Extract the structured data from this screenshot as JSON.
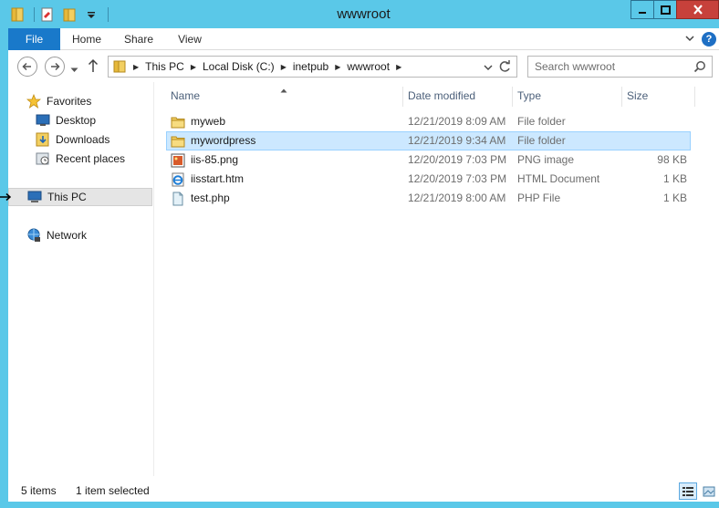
{
  "window": {
    "title": "wwwroot"
  },
  "ribbon": {
    "tabs": [
      {
        "label": "File"
      },
      {
        "label": "Home"
      },
      {
        "label": "Share"
      },
      {
        "label": "View"
      }
    ]
  },
  "address": {
    "crumbs": [
      "This PC",
      "Local Disk (C:)",
      "inetpub",
      "wwwroot"
    ]
  },
  "search": {
    "placeholder": "Search wwwroot"
  },
  "navpane": {
    "favorites": "Favorites",
    "desktop": "Desktop",
    "downloads": "Downloads",
    "recent": "Recent places",
    "thispc": "This PC",
    "network": "Network"
  },
  "columns": {
    "name": "Name",
    "date": "Date modified",
    "type": "Type",
    "size": "Size"
  },
  "files": [
    {
      "name": "myweb",
      "date": "12/21/2019 8:09 AM",
      "type": "File folder",
      "size": "",
      "icon": "folder-icon"
    },
    {
      "name": "mywordpress",
      "date": "12/21/2019 9:34 AM",
      "type": "File folder",
      "size": "",
      "icon": "folder-icon"
    },
    {
      "name": "iis-85.png",
      "date": "12/20/2019 7:03 PM",
      "type": "PNG image",
      "size": "98 KB",
      "icon": "image-file-icon"
    },
    {
      "name": "iisstart.htm",
      "date": "12/20/2019 7:03 PM",
      "type": "HTML Document",
      "size": "1 KB",
      "icon": "html-file-icon"
    },
    {
      "name": "test.php",
      "date": "12/21/2019 8:00 AM",
      "type": "PHP File",
      "size": "1 KB",
      "icon": "generic-file-icon"
    }
  ],
  "status": {
    "items": "5 items",
    "selected": "1 item selected"
  },
  "colors": {
    "accent": "#1979ca",
    "titlebar": "#5ac8e8",
    "selection": "#cce8ff",
    "close": "#c7413b"
  }
}
